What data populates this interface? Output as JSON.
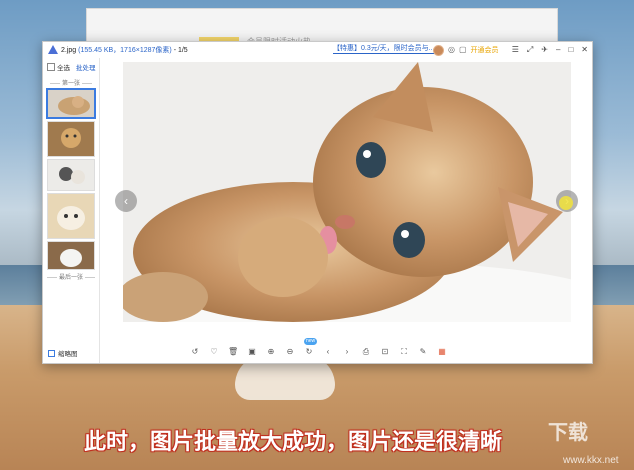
{
  "window": {
    "title_file": "2.jpg",
    "title_meta": "(155.45 KB，1716×1287像素)",
    "title_index": "- 1/5",
    "promo_link": "【特惠】0.3元/天，限时会员与...",
    "vip_label": "开通会员"
  },
  "background_window": {
    "title": "会员限时活动火热"
  },
  "left_panel": {
    "select_all": "全选",
    "batch_link": "批处理",
    "first_label": "第一张",
    "last_label": "最后一张",
    "thumbnail_view": "缩略图",
    "thumbnails": [
      "kitten-lying",
      "kitten-sitting",
      "kittens-pair",
      "cat-face",
      "cat-white"
    ]
  },
  "toolbar": {
    "new_badge": "new",
    "tools": [
      "rotate-icon",
      "heart-icon",
      "delete-icon",
      "compare-icon",
      "zoom-in-icon",
      "zoom-out-icon",
      "refresh-icon",
      "prev-icon",
      "next-icon",
      "print-icon",
      "scan-icon",
      "fullscreen-icon",
      "edit-icon",
      "apps-icon"
    ]
  },
  "caption": "此时，图片批量放大成功，图片还是很清晰",
  "watermark": {
    "brand": "下载",
    "url": "www.kkx.net"
  },
  "colors": {
    "accent": "#2a64c8",
    "vip": "#e8a400",
    "caption_outline": "#c03020"
  }
}
